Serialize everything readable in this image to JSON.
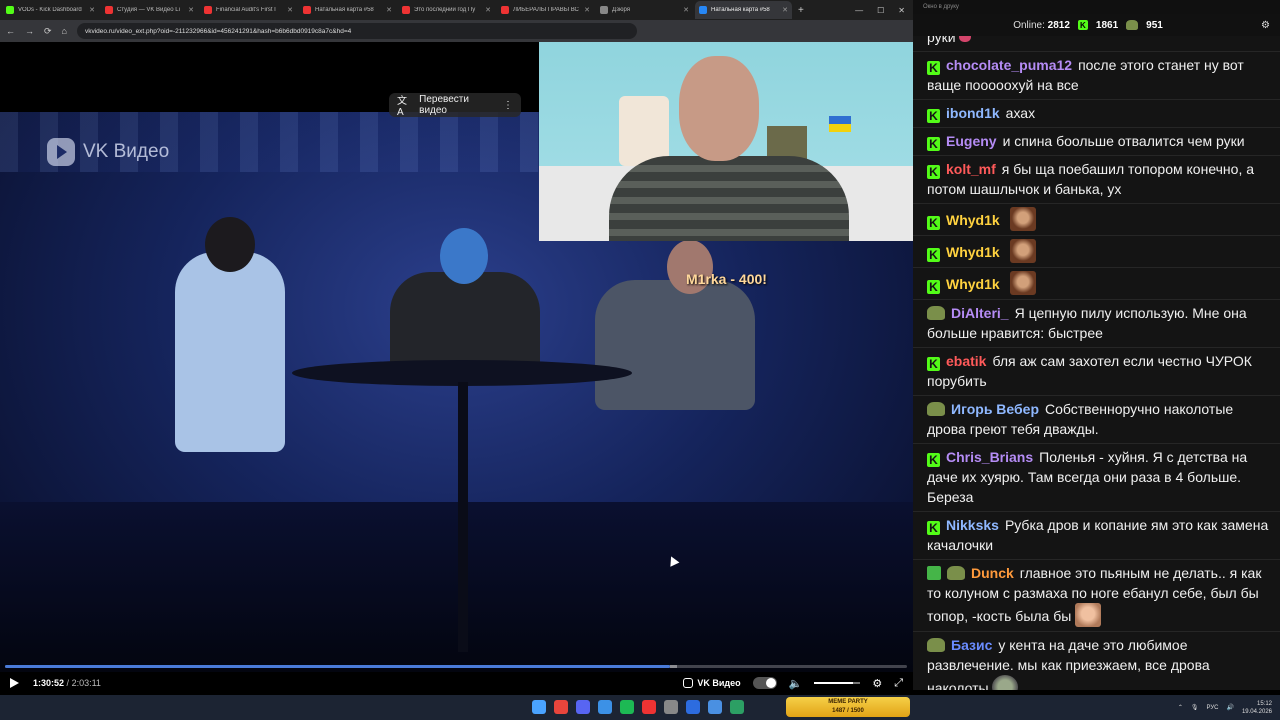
{
  "browser": {
    "tabs": [
      {
        "label": "VODs - Kick Dashboard",
        "color": "#53fc18",
        "active": false
      },
      {
        "label": "Студия — VK Видео Li",
        "color": "#e33",
        "active": false
      },
      {
        "label": "Financial Audit's First I",
        "color": "#e33",
        "active": false
      },
      {
        "label": "Натальная карта #58",
        "color": "#e33",
        "active": false
      },
      {
        "label": "Это последний год Пу",
        "color": "#e33",
        "active": false
      },
      {
        "label": "ЛИБЕРАЛЫ ПРАВЫ ВС",
        "color": "#e33",
        "active": false
      },
      {
        "label": "Дзюря",
        "color": "#888",
        "active": false
      },
      {
        "label": "Натальная карта #58",
        "color": "#2787f5",
        "active": true
      }
    ],
    "address": "vkvideo.ru/video_ext.php?oid=-211232966&id=456241291&hash=b6b6dbd0919c8a7c&hd=4"
  },
  "video": {
    "brand": "VK Видео",
    "translate_label": "Перевести видео",
    "overlay_text": "M1rka - 400!",
    "current_time": "1:30:52",
    "duration": "2:03:11",
    "progress": 0.7374,
    "buffered": 0.745,
    "volume": 0.85,
    "player_brand": "VK Видео"
  },
  "chat_window": {
    "title": "Окно в друку",
    "online_label": "Online:",
    "online_count": "2812",
    "stat_a": "1861",
    "stat_b": "951"
  },
  "chat": [
    {
      "user": "",
      "color": "#fff",
      "badge": "none",
      "text": "руки",
      "emote": "heart"
    },
    {
      "user": "chocolate_puma12",
      "color": "#b58cf5",
      "badge": "kick",
      "text": "после этого станет ну вот ваще пооооохуй на все",
      "emote": ""
    },
    {
      "user": "ibond1k",
      "color": "#8fb8ff",
      "badge": "kick",
      "text": "ахах",
      "emote": ""
    },
    {
      "user": "Eugeny",
      "color": "#b58cf5",
      "badge": "kick",
      "text": "и спина боольше отвалится чем руки",
      "emote": ""
    },
    {
      "user": "kolt_mf",
      "color": "#ff5a5a",
      "badge": "kick",
      "text": "я бы ща поебашил топором конечно, а потом шашлычок и банька, ух",
      "emote": ""
    },
    {
      "user": "Whyd1k",
      "color": "#ffd23f",
      "badge": "kick",
      "text": "",
      "emote": "monkey"
    },
    {
      "user": "Whyd1k",
      "color": "#ffd23f",
      "badge": "kick",
      "text": "",
      "emote": "monkey"
    },
    {
      "user": "Whyd1k",
      "color": "#ffd23f",
      "badge": "kick",
      "text": "",
      "emote": "monkey"
    },
    {
      "user": "DiAlteri_",
      "color": "#b58cf5",
      "badge": "pepe",
      "text": "Я цепную пилу использую. Мне она больше нравится: быстрее",
      "emote": ""
    },
    {
      "user": "ebatik",
      "color": "#ff5a5a",
      "badge": "kick",
      "text": "бля аж сам захотел если честно ЧУРОК порубить",
      "emote": ""
    },
    {
      "user": "Игорь Вебер",
      "color": "#8fb8ff",
      "badge": "pepe",
      "text": "Собственноручно наколотые дрова греют тебя дважды.",
      "emote": ""
    },
    {
      "user": "Chris_Brians",
      "color": "#b58cf5",
      "badge": "kick",
      "text": "Поленья - хуйня. Я с детства на даче их хуярю. Там всегда они раза в 4 больше. Береза",
      "emote": ""
    },
    {
      "user": "Nikksks",
      "color": "#8fb8ff",
      "badge": "kick",
      "text": "Рубка дров и копание ям это как замена качалочки",
      "emote": ""
    },
    {
      "user": "Dunck",
      "color": "#ff9a3c",
      "badge": "penpepe",
      "text": "главное это пьяным не делать.. я как то колуном с размаха по ноге ебанул себе, был бы топор, -кость была бы",
      "emote": "face"
    },
    {
      "user": "Базис",
      "color": "#6a8cff",
      "badge": "pepe",
      "text": "у кента на даче это любимое развлечение. мы как приезжаем, все дрова наколоты",
      "emote": "pepe-e"
    }
  ],
  "taskbar": {
    "meme_title": "MEME PARTY",
    "meme_sub": "1487 / 1500",
    "lang": "РУС",
    "time": "15:12",
    "date": "19.04.2026"
  }
}
